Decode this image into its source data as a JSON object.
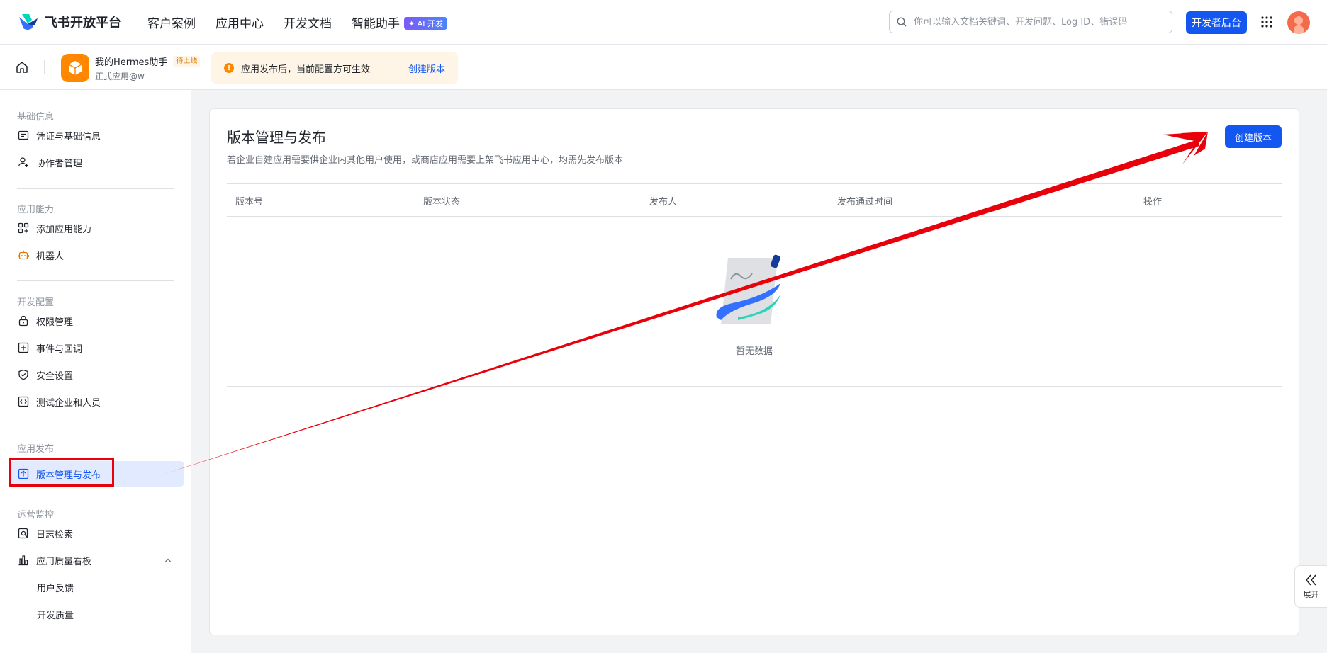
{
  "header": {
    "logo_text": "飞书开放平台",
    "nav": [
      {
        "label": "客户案例"
      },
      {
        "label": "应用中心"
      },
      {
        "label": "开发文档"
      },
      {
        "label": "智能助手",
        "badge": "✦ AI 开发"
      }
    ],
    "search_placeholder": "你可以输入文档关键词、开发问题、Log ID、错误码",
    "console_button": "开发者后台"
  },
  "app_bar": {
    "app_name": "我的Hermes助手",
    "status_tag": "待上线",
    "app_type": "正式应用@w",
    "notice_icon": "!",
    "notice_text": "应用发布后，当前配置方可生效",
    "notice_link": "创建版本"
  },
  "sidebar": {
    "groups": [
      {
        "label": "基础信息",
        "items": [
          {
            "label": "凭证与基础信息",
            "icon": "id-card-icon"
          },
          {
            "label": "协作者管理",
            "icon": "user-add-icon"
          }
        ]
      },
      {
        "label": "应用能力",
        "items": [
          {
            "label": "添加应用能力",
            "icon": "apps-add-icon"
          },
          {
            "label": "机器人",
            "icon": "robot-icon"
          }
        ]
      },
      {
        "label": "开发配置",
        "items": [
          {
            "label": "权限管理",
            "icon": "lock-icon"
          },
          {
            "label": "事件与回调",
            "icon": "event-icon"
          },
          {
            "label": "安全设置",
            "icon": "shield-icon"
          },
          {
            "label": "测试企业和人员",
            "icon": "code-icon"
          }
        ]
      },
      {
        "label": "应用发布",
        "items": [
          {
            "label": "版本管理与发布",
            "icon": "upload-icon",
            "active": true
          }
        ]
      },
      {
        "label": "运营监控",
        "items": [
          {
            "label": "日志检索",
            "icon": "log-search-icon"
          },
          {
            "label": "应用质量看板",
            "icon": "chart-bar-icon"
          },
          {
            "label": "用户反馈"
          },
          {
            "label": "开发质量"
          }
        ]
      }
    ]
  },
  "main": {
    "title": "版本管理与发布",
    "description": "若企业自建应用需要供企业内其他用户使用，或商店应用需要上架飞书应用中心，均需先发布版本",
    "create_button": "创建版本",
    "columns": [
      "版本号",
      "版本状态",
      "发布人",
      "发布通过时间",
      "操作"
    ],
    "empty_text": "暂无数据"
  },
  "expand_tab": {
    "icon": "double-chevron-left-icon",
    "label": "展开"
  },
  "colors": {
    "primary": "#1456f0",
    "annotation_red": "#e8000b",
    "warning": "#ff8800"
  }
}
